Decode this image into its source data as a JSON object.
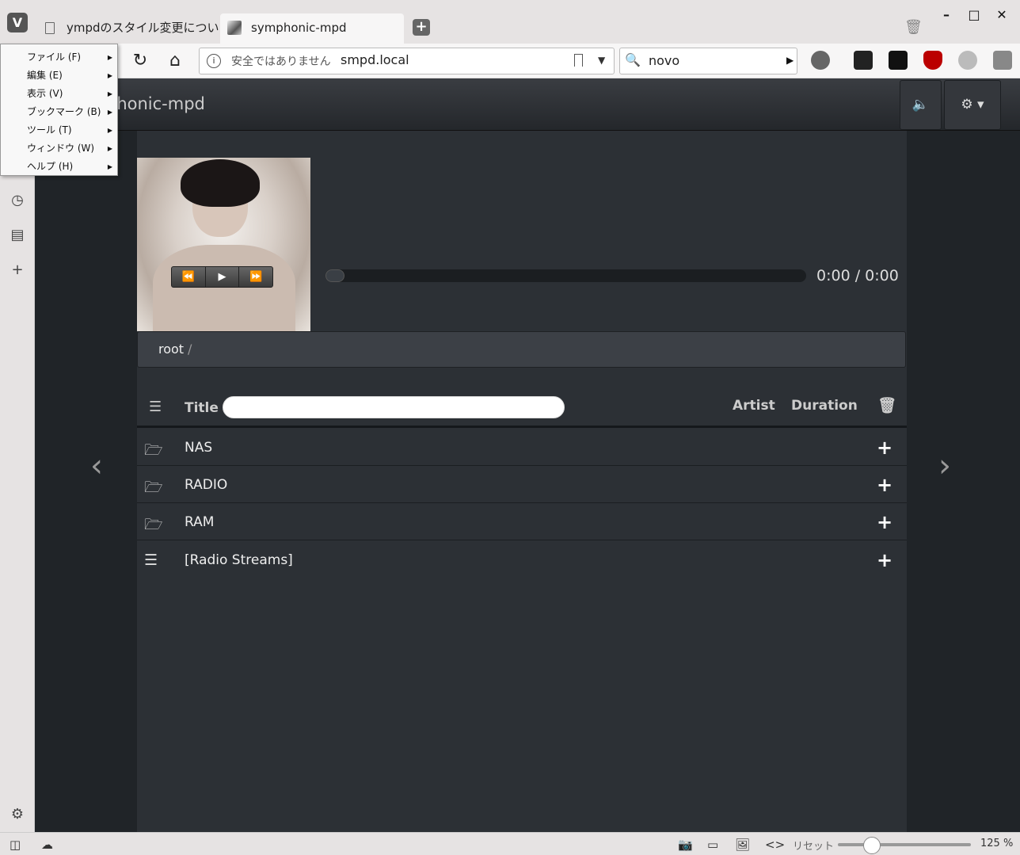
{
  "browser": {
    "menu_button_label": "V",
    "tabs": [
      {
        "title": "ympdのスタイル変更につい"
      },
      {
        "title": "symphonic-mpd"
      }
    ],
    "new_tab_label": "+",
    "address": {
      "security_text": "安全ではありません",
      "url": "smpd.local"
    },
    "search": {
      "engine_icon": "search-icon",
      "value": "novo"
    },
    "menu": [
      {
        "label": "ファイル (F)"
      },
      {
        "label": "編集 (E)"
      },
      {
        "label": "表示 (V)"
      },
      {
        "label": "ブックマーク (B)"
      },
      {
        "label": "ツール (T)"
      },
      {
        "label": "ウィンドウ (W)"
      },
      {
        "label": "ヘルプ (H)"
      }
    ],
    "statusbar": {
      "reset_label": "リセット",
      "zoom": "125 %"
    }
  },
  "app": {
    "brand": "phonic-mpd",
    "time": "0:00 / 0:00",
    "progress_fraction": 0.04,
    "breadcrumb": {
      "root": "root",
      "sep": "/"
    },
    "table_headers": {
      "title": "Title",
      "artist": "Artist",
      "duration": "Duration"
    },
    "rows": [
      {
        "icon": "folder-icon",
        "name": "NAS"
      },
      {
        "icon": "folder-icon",
        "name": "RADIO"
      },
      {
        "icon": "folder-icon",
        "name": "RAM"
      },
      {
        "icon": "list-icon",
        "name": "[Radio Streams]"
      }
    ]
  },
  "colors": {
    "page_bg": "#2c3035",
    "panel_bg": "#202428",
    "menu_bg": "#f8f8f8"
  }
}
